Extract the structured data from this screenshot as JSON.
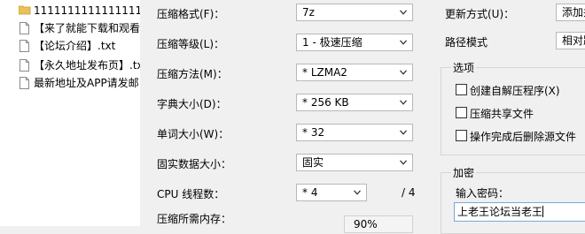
{
  "file_list": {
    "items": [
      {
        "type": "folder",
        "name": "11111111111111111"
      },
      {
        "type": "file",
        "name": "【来了就能下载和观看"
      },
      {
        "type": "file",
        "name": "【论坛介绍】.txt"
      },
      {
        "type": "file",
        "name": "【永久地址发布页】.tx"
      },
      {
        "type": "file",
        "name": "最新地址及APP请发邮"
      }
    ]
  },
  "options": {
    "format_label": "压缩格式(F)：",
    "format_value": "7z",
    "level_label": "压缩等级(L)：",
    "level_value": "1 - 极速压缩",
    "method_label": "压缩方法(M)：",
    "method_value": "* LZMA2",
    "dict_label": "字典大小(D)：",
    "dict_value": "* 256 KB",
    "word_label": "单词大小(W)：",
    "word_value": "* 32",
    "solid_label": "固实数据大小：",
    "solid_value": "固实",
    "cpu_label": "CPU 线程数：",
    "cpu_value": "* 4",
    "cpu_total": "/ 4",
    "memory_label": "压缩所需内存：",
    "memory_value": "90%"
  },
  "right": {
    "update_label": "更新方式(U)：",
    "update_value": "添加并",
    "path_label": "路径模式",
    "path_value": "相对路",
    "options_group": "选项",
    "sfx_label": "创建自解压程序(X)",
    "shared_label": "压缩共享文件",
    "delete_label": "操作完成后删除源文件",
    "encrypt_group": "加密",
    "password_label": "输入密码：",
    "password_value": "上老王论坛当老王"
  }
}
